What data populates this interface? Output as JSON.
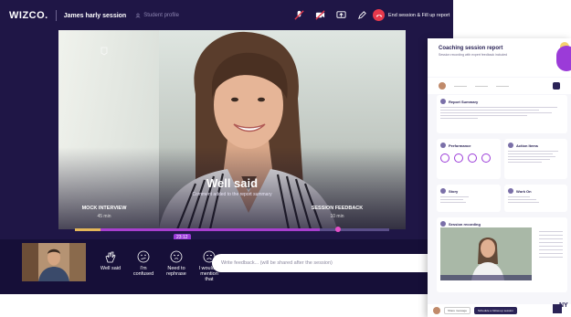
{
  "app": {
    "logo": "WIZCO.",
    "session_title": "James harly session",
    "student_profile": "Student profile",
    "end_session": "End session & Fill up report"
  },
  "video": {
    "headline": "Well said",
    "comment_note": "Comment added to the report summary",
    "mock_label": "MOCK INTERVIEW",
    "mock_duration": "45 min",
    "feedback_label": "SESSION FEEDBACK",
    "feedback_duration": "10 min"
  },
  "progress": {
    "time": "23:12",
    "fraction": 0.78
  },
  "reactions": [
    {
      "icon": "clap-icon",
      "label": "Well said"
    },
    {
      "icon": "confused-face-icon",
      "label": "I'm confused"
    },
    {
      "icon": "rephrase-face-icon",
      "label": "Need to rephrase"
    },
    {
      "icon": "sad-face-icon",
      "label": "I wouldn't mention that"
    }
  ],
  "feedback": {
    "placeholder": "Write feedback... (will be shared after the session)"
  },
  "report": {
    "title": "Coaching session report",
    "subtitle": "Session recording with expert feedback included",
    "summary": "Report Summary",
    "performance": "Performance",
    "action_items": "Action Items",
    "story": "Story",
    "work_on": "Work On",
    "recording": "Session recording",
    "footer_btn1": "Share message",
    "footer_btn2": "Schedule a follow-up session",
    "brand": "NY"
  },
  "colors": {
    "app_bg": "#1f1646",
    "accent_purple": "#9b3bd8",
    "accent_yellow": "#e3b65a",
    "end_red": "#e8394c"
  }
}
